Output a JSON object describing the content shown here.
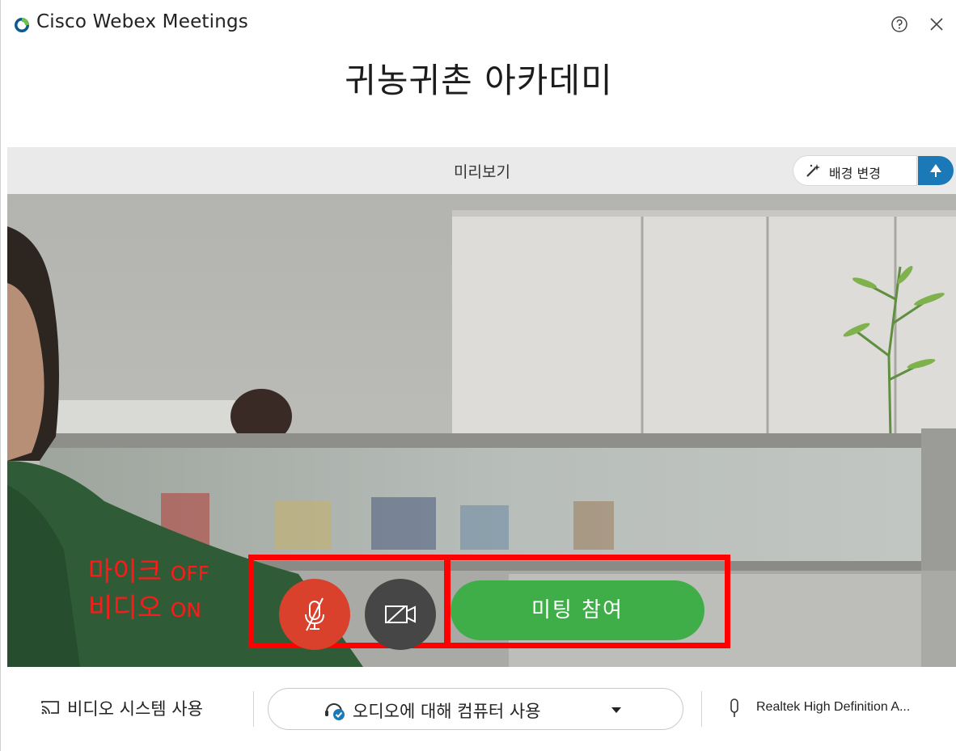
{
  "window": {
    "app_name": "Cisco Webex Meetings",
    "help_icon": "help-circle-icon",
    "close_icon": "close-icon"
  },
  "meeting": {
    "title": "귀농귀촌 아카데미"
  },
  "preview": {
    "label": "미리보기",
    "background_button_label": "배경 변경",
    "background_icon": "magic-wand-icon",
    "toggle_icon": "blur-tree-icon"
  },
  "controls": {
    "mic_state": "muted",
    "mic_icon": "mic-off-icon",
    "video_icon": "video-camera-icon",
    "join_label": "미팅 참여",
    "colors": {
      "mic": "#d9412c",
      "video": "#464646",
      "join": "#3fae49",
      "annotation": "#ff0000"
    }
  },
  "annotation": {
    "line1_ko": "마이크",
    "line1_en": "OFF",
    "line2_ko": "비디오",
    "line2_en": "ON"
  },
  "footer": {
    "video_system_label": "비디오 시스템 사용",
    "audio_label": "오디오에 대해 컴퓨터 사용",
    "mic_device_label": "Realtek High Definition A..."
  }
}
